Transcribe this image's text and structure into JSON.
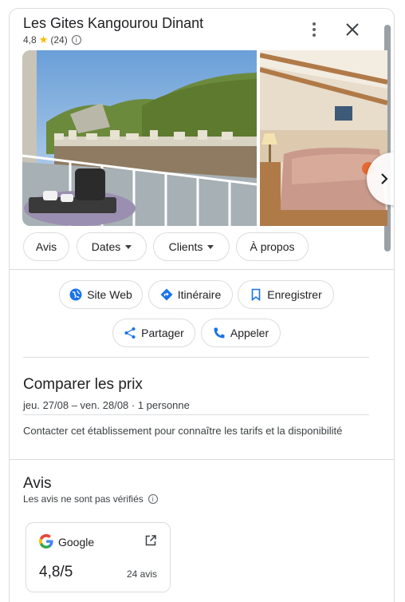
{
  "header": {
    "title": "Les Gites Kangourou Dinant",
    "rating": "4,8",
    "review_count": "(24)"
  },
  "filters": [
    {
      "label": "Avis"
    },
    {
      "label": "Dates"
    },
    {
      "label": "Clients"
    },
    {
      "label": "À propos"
    }
  ],
  "actions": {
    "website": "Site Web",
    "directions": "Itinéraire",
    "save": "Enregistrer",
    "share": "Partager",
    "call": "Appeler"
  },
  "prices": {
    "title": "Comparer les prix",
    "dates": "jeu. 27/08 – ven. 28/08 · 1 personne",
    "note": "Contacter cet établissement pour connaître les tarifs et la disponibilité"
  },
  "reviews": {
    "title": "Avis",
    "disclaimer": "Les avis ne sont pas vérifiés",
    "source": "Google",
    "score": "4,8/5",
    "count": "24 avis"
  },
  "colors": {
    "accent": "#1a73e8",
    "star": "#fbbc04",
    "border": "#dadce0"
  }
}
